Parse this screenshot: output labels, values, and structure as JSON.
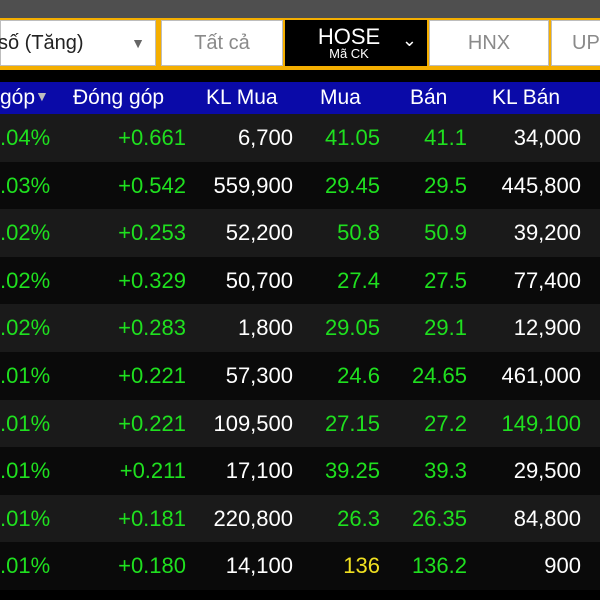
{
  "toolbar": {
    "sort_select": "số (Tăng)",
    "filter_all": "Tất cả",
    "exchange": "HOSE",
    "exchange_sub": "Mã CK",
    "hnx": "HNX",
    "upcom": "UP"
  },
  "header": {
    "col_pct": "góp",
    "col_contrib": "Đóng góp",
    "col_buy_vol": "KL Mua",
    "col_buy": "Mua",
    "col_sell": "Bán",
    "col_sell_vol": "KL Bán"
  },
  "rows": [
    {
      "pct": ".04%",
      "contrib": "+0.661",
      "buy_vol": "6,700",
      "buy": "41.05",
      "sell": "41.1",
      "sell_vol": "34,000"
    },
    {
      "pct": ".03%",
      "contrib": "+0.542",
      "buy_vol": "559,900",
      "buy": "29.45",
      "sell": "29.5",
      "sell_vol": "445,800"
    },
    {
      "pct": ".02%",
      "contrib": "+0.253",
      "buy_vol": "52,200",
      "buy": "50.8",
      "sell": "50.9",
      "sell_vol": "39,200"
    },
    {
      "pct": ".02%",
      "contrib": "+0.329",
      "buy_vol": "50,700",
      "buy": "27.4",
      "sell": "27.5",
      "sell_vol": "77,400"
    },
    {
      "pct": ".02%",
      "contrib": "+0.283",
      "buy_vol": "1,800",
      "buy": "29.05",
      "sell": "29.1",
      "sell_vol": "12,900"
    },
    {
      "pct": ".01%",
      "contrib": "+0.221",
      "buy_vol": "57,300",
      "buy": "24.6",
      "sell": "24.65",
      "sell_vol": "461,000"
    },
    {
      "pct": ".01%",
      "contrib": "+0.221",
      "buy_vol": "109,500",
      "buy": "27.15",
      "sell": "27.2",
      "sell_vol": "149,100"
    },
    {
      "pct": ".01%",
      "contrib": "+0.211",
      "buy_vol": "17,100",
      "buy": "39.25",
      "sell": "39.3",
      "sell_vol": "29,500"
    },
    {
      "pct": ".01%",
      "contrib": "+0.181",
      "buy_vol": "220,800",
      "buy": "26.3",
      "sell": "26.35",
      "sell_vol": "84,800"
    },
    {
      "pct": ".01%",
      "contrib": "+0.180",
      "buy_vol": "14,100",
      "buy": "136",
      "sell": "136.2",
      "sell_vol": "900"
    }
  ],
  "colors": {
    "header_bg": "#0a0aa8",
    "toolbar_bg": "#f4ae00",
    "up_green": "#1fe01f",
    "ceiling_yellow": "#f0e020",
    "neutral_white": "#ffffff"
  }
}
